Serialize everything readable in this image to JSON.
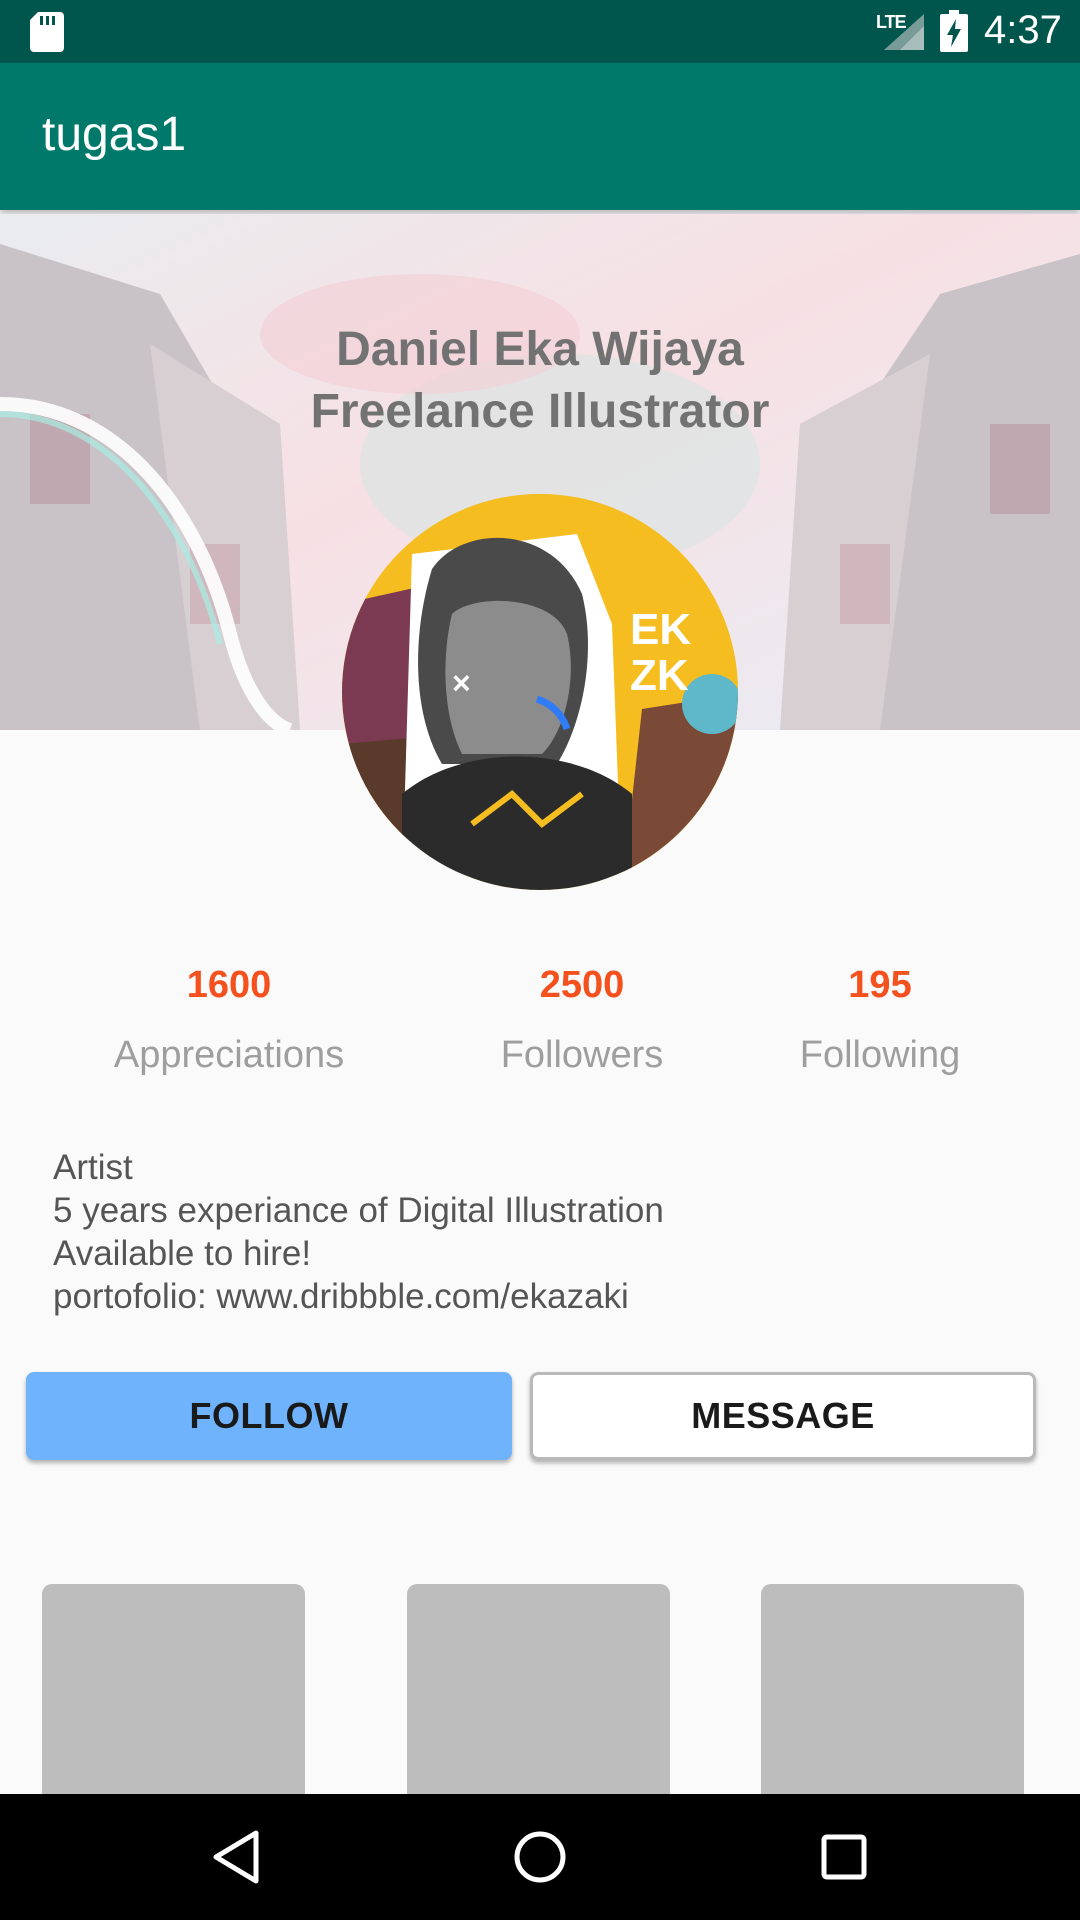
{
  "status_bar": {
    "time": "4:37",
    "network": "LTE",
    "icons": [
      "sd-card-icon",
      "signal-icon",
      "battery-charging-icon"
    ]
  },
  "app_bar": {
    "title": "tugas1"
  },
  "profile": {
    "name": "Daniel Eka Wijaya",
    "role": "Freelance Illustrator",
    "avatar_text": [
      "EK",
      "ZK"
    ]
  },
  "stats": [
    {
      "value": "1600",
      "label": "Appreciations"
    },
    {
      "value": "2500",
      "label": "Followers"
    },
    {
      "value": "195",
      "label": "Following"
    }
  ],
  "bio": [
    "Artist",
    "5 years experiance of Digital Illustration",
    "Available to hire!",
    "portofolio: www.dribbble.com/ekazaki"
  ],
  "actions": {
    "follow": "FOLLOW",
    "message": "MESSAGE"
  },
  "nav_bar": {
    "icons": [
      "back-icon",
      "home-icon",
      "recents-icon"
    ]
  },
  "colors": {
    "status_bar": "#00564d",
    "app_bar": "#00796b",
    "stat_value": "#f4511e",
    "follow_button": "#6fb3fc",
    "thumbnail": "#bdbdbd"
  }
}
